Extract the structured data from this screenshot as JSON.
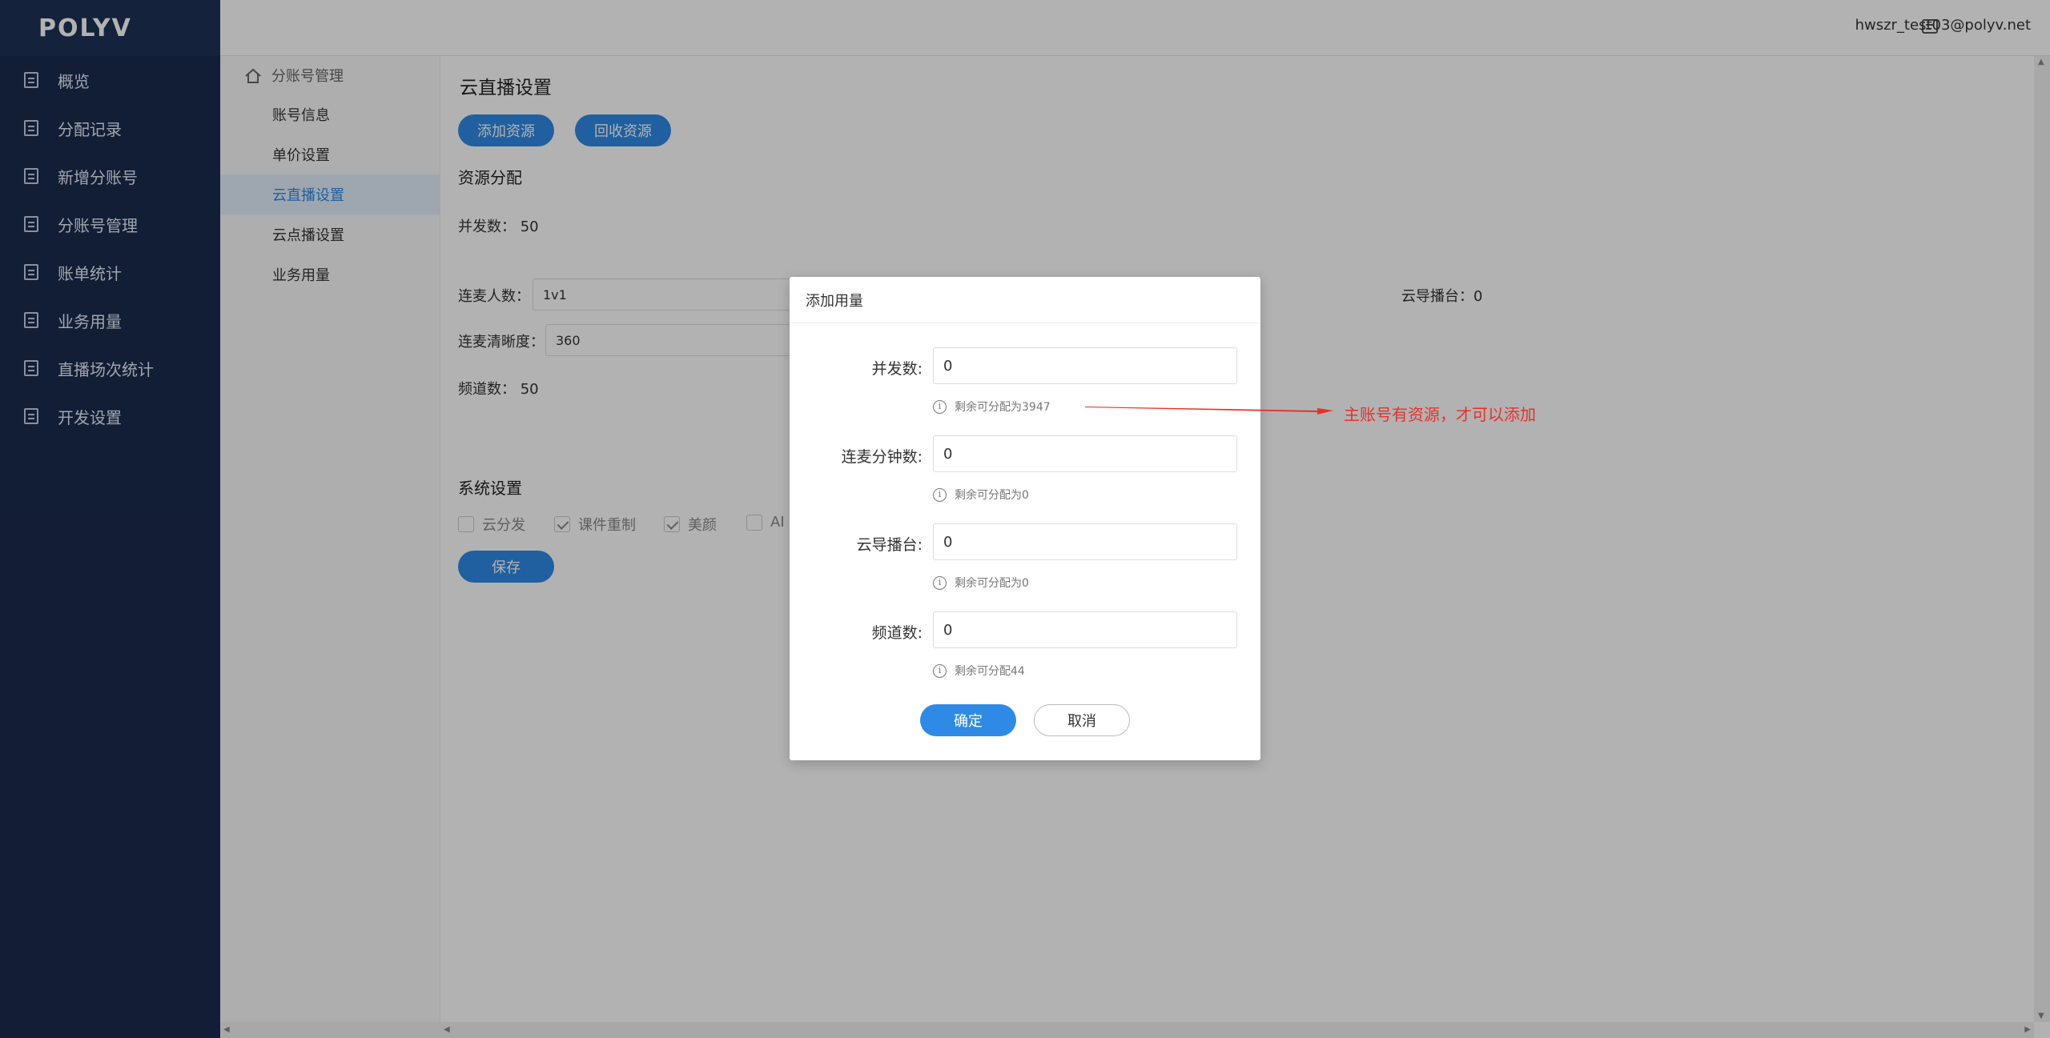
{
  "brand": {
    "logo": "POLYV"
  },
  "sidebar": {
    "items": [
      {
        "label": "概览"
      },
      {
        "label": "分配记录"
      },
      {
        "label": "新增分账号"
      },
      {
        "label": "分账号管理"
      },
      {
        "label": "账单统计"
      },
      {
        "label": "业务用量"
      },
      {
        "label": "直播场次统计"
      },
      {
        "label": "开发设置"
      }
    ]
  },
  "header": {
    "user": "hwszr_test03@polyv.net"
  },
  "subnav": {
    "title": "分账号管理",
    "items": [
      {
        "label": "账号信息"
      },
      {
        "label": "单价设置"
      },
      {
        "label": "云直播设置"
      },
      {
        "label": "云点播设置"
      },
      {
        "label": "业务用量"
      }
    ],
    "active_index": 2
  },
  "main": {
    "title": "云直播设置",
    "add_resource": "添加资源",
    "recycle_resource": "回收资源",
    "resource_section": "资源分配",
    "concurrency": "并发数： 50",
    "mic_people_label": "连麦人数：",
    "mic_people_value": "1v1",
    "director_label": "云导播台：",
    "director_value": "0",
    "mic_clarity_label": "连麦清晰度：",
    "mic_clarity_value": "360",
    "channels": "频道数： 50",
    "system_section": "系统设置",
    "checks": [
      {
        "label": "云分发",
        "checked": false
      },
      {
        "label": "课件重制",
        "checked": true
      },
      {
        "label": "美颜",
        "checked": true
      },
      {
        "label": "AI",
        "checked": false
      }
    ],
    "save": "保存"
  },
  "modal": {
    "title": "添加用量",
    "fields": [
      {
        "label": "并发数:",
        "value": "0",
        "hint": "剩余可分配为3947"
      },
      {
        "label": "连麦分钟数:",
        "value": "0",
        "hint": "剩余可分配为0"
      },
      {
        "label": "云导播台:",
        "value": "0",
        "hint": "剩余可分配为0"
      },
      {
        "label": "频道数:",
        "value": "0",
        "hint": "剩余可分配44"
      }
    ],
    "ok": "确定",
    "cancel": "取消"
  },
  "annotation": {
    "text": "主账号有资源，才可以添加",
    "color": "#e8302a"
  },
  "colors": {
    "accent": "#2f8ae6",
    "sidebar_bg": "#1b2a4e"
  }
}
